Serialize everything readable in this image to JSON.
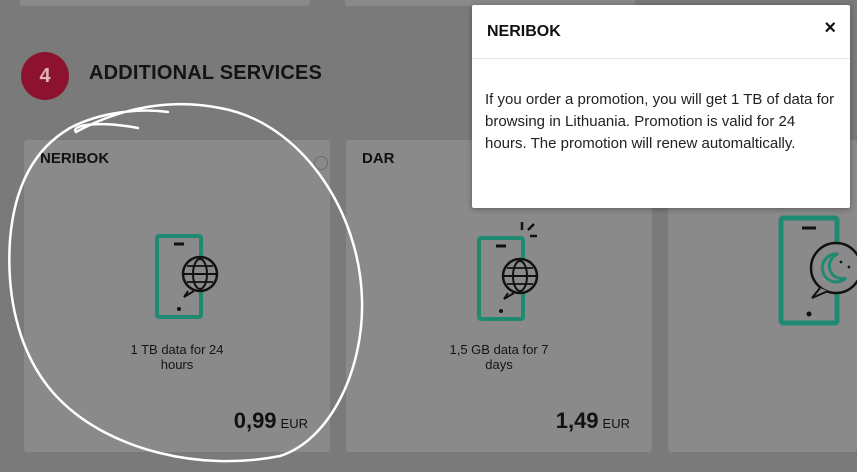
{
  "section": {
    "step_number": "4",
    "title": "ADDITIONAL SERVICES"
  },
  "cards": [
    {
      "title": "NERIBOK",
      "desc_line1": "1 TB data for 24",
      "desc_line2": "hours",
      "price": "0,99",
      "currency": "EUR"
    },
    {
      "title": "DAR",
      "desc_line1": "1,5 GB data for 7",
      "desc_line2": "days",
      "price": "1,49",
      "currency": "EUR"
    },
    {
      "title": ""
    }
  ],
  "popup": {
    "title": "NERIBOK",
    "close": "×",
    "body": "If you order a promotion, you will get 1 TB of data for browsing in Lithuania. Promotion is valid for 24 hours. The promotion will renew automaltically."
  },
  "colors": {
    "badge": "#8c1230",
    "teal": "#1f8a72",
    "overlay": "#7a7a7a"
  },
  "icons": [
    "phone-globe-icon",
    "phone-globe-icon",
    "phone-moon-chat-icon",
    "info-icon",
    "close-icon"
  ]
}
